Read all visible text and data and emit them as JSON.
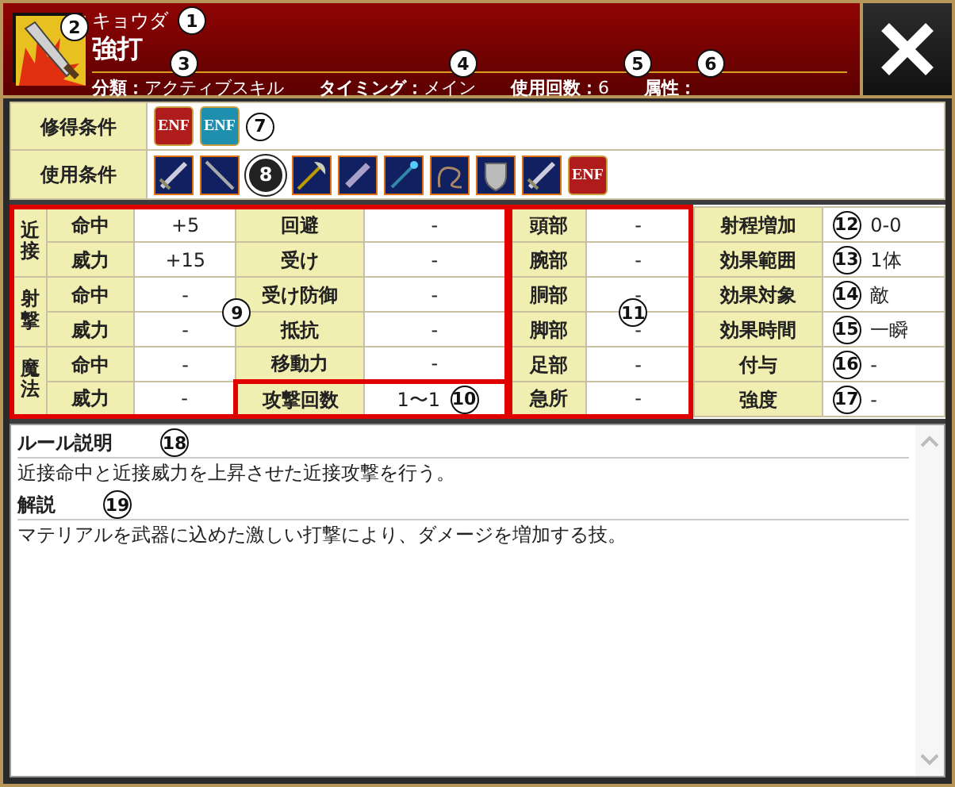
{
  "header": {
    "reading": "キョウダ",
    "reading_callout": "1",
    "name": "強打",
    "icon_callout": "2",
    "meta": [
      {
        "label": "分類：",
        "value": "アクティブスキル",
        "callout": "3"
      },
      {
        "label": "タイミング：",
        "value": "メイン",
        "callout": "4"
      },
      {
        "label": "使用回数：",
        "value": "6",
        "callout": "5"
      },
      {
        "label": "属性：",
        "callout": "6"
      }
    ]
  },
  "conditions": [
    {
      "label": "修得条件",
      "callout": "7",
      "icons": [
        {
          "kind": "enf",
          "text": "ENF",
          "color": "#b01c1c"
        },
        {
          "kind": "enf",
          "text": "ENF",
          "color": "#1f8fb0"
        }
      ]
    },
    {
      "label": "使用条件",
      "icons": [
        {
          "kind": "sword"
        },
        {
          "kind": "spear"
        },
        {
          "kind": "callout",
          "text": "8"
        },
        {
          "kind": "axe"
        },
        {
          "kind": "dagger"
        },
        {
          "kind": "staff"
        },
        {
          "kind": "whip"
        },
        {
          "kind": "shield"
        },
        {
          "kind": "sword"
        },
        {
          "kind": "enf",
          "text": "ENF",
          "color": "#b01c1c"
        }
      ]
    }
  ],
  "combat_callout": "9",
  "combat": [
    {
      "category": "近接",
      "rows": [
        {
          "label": "命中",
          "value": "+5"
        },
        {
          "label": "威力",
          "value": "+15"
        }
      ]
    },
    {
      "category": "射撃",
      "rows": [
        {
          "label": "命中",
          "value": "-"
        },
        {
          "label": "威力",
          "value": "-"
        }
      ]
    },
    {
      "category": "魔法",
      "rows": [
        {
          "label": "命中",
          "value": "-"
        },
        {
          "label": "威力",
          "value": "-"
        }
      ]
    }
  ],
  "defense": [
    {
      "label": "回避",
      "value": "-"
    },
    {
      "label": "受け",
      "value": "-"
    },
    {
      "label": "受け防御",
      "value": "-"
    },
    {
      "label": "抵抗",
      "value": "-"
    },
    {
      "label": "移動力",
      "value": "-"
    },
    {
      "label": "攻撃回数",
      "value": "1〜1",
      "callout": "10"
    }
  ],
  "body_parts_callout": "11",
  "body_parts": [
    {
      "label": "頭部",
      "value": "-"
    },
    {
      "label": "腕部",
      "value": "-"
    },
    {
      "label": "胴部",
      "value": "-"
    },
    {
      "label": "脚部",
      "value": "-"
    },
    {
      "label": "足部",
      "value": "-"
    },
    {
      "label": "急所",
      "value": "-"
    }
  ],
  "effects": [
    {
      "label": "射程増加",
      "value": "0-0",
      "callout": "12"
    },
    {
      "label": "効果範囲",
      "value": "1体",
      "callout": "13"
    },
    {
      "label": "効果対象",
      "value": "敵",
      "callout": "14"
    },
    {
      "label": "効果時間",
      "value": "一瞬",
      "callout": "15"
    },
    {
      "label": "付与",
      "value": "-",
      "callout": "16"
    },
    {
      "label": "強度",
      "value": "-",
      "callout": "17"
    }
  ],
  "description": [
    {
      "heading": "ルール説明",
      "callout": "18",
      "text": "近接命中と近接威力を上昇させた近接攻撃を行う。"
    },
    {
      "heading": "解説",
      "callout": "19",
      "text": "マテリアルを武器に込めた激しい打撃により、ダメージを増加する技。"
    }
  ]
}
